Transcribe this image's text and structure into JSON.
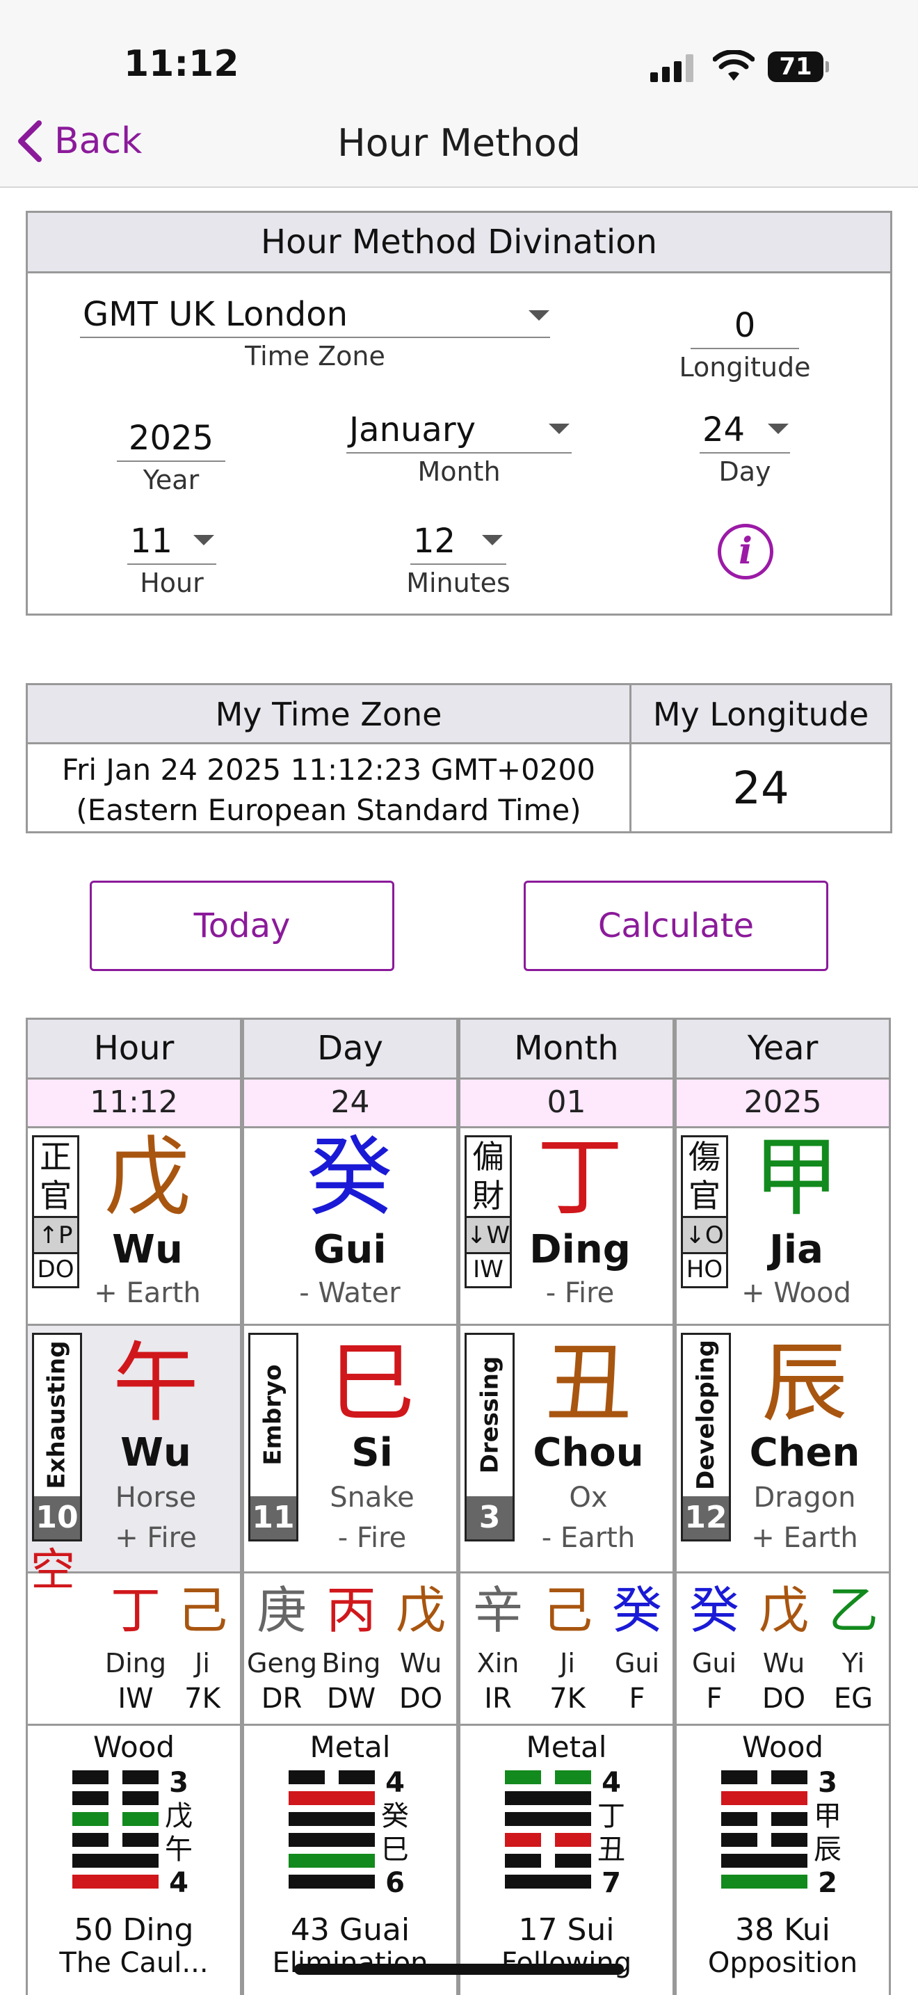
{
  "status": {
    "time": "11:12",
    "battery": "71"
  },
  "nav": {
    "back_label": "Back",
    "title": "Hour Method"
  },
  "panel": {
    "title": "Hour Method Divination",
    "timezone": {
      "value": "GMT UK London",
      "label": "Time Zone"
    },
    "longitude": {
      "value": "0",
      "label": "Longitude"
    },
    "year": {
      "value": "2025",
      "label": "Year"
    },
    "month": {
      "value": "January",
      "label": "Month"
    },
    "day": {
      "value": "24",
      "label": "Day"
    },
    "hour": {
      "value": "11",
      "label": "Hour"
    },
    "minutes": {
      "value": "12",
      "label": "Minutes"
    },
    "info_glyph": "i"
  },
  "mytz": {
    "tz_header": "My Time Zone",
    "lon_header": "My Longitude",
    "tz_line1": "Fri Jan 24 2025 11:12:23 GMT+0200",
    "tz_line2": "(Eastern European Standard Time)",
    "lon_value": "24"
  },
  "buttons": {
    "today": "Today",
    "calculate": "Calculate"
  },
  "colors": {
    "accent": "#8b1a9a",
    "fire": "#d0171b",
    "earth": "#a85510",
    "water": "#1a1ad6",
    "wood": "#128a1d",
    "metal": "#666666"
  },
  "pillars": [
    {
      "header": "Hour",
      "sub": "11:12",
      "stem": {
        "char": "戊",
        "pinyin": "Wu",
        "element": "+ Earth",
        "color": "#a85510",
        "god_chars": "正官",
        "god_mid": "↑P",
        "god_bot": "DO"
      },
      "branch": {
        "char": "午",
        "pinyin": "Wu",
        "animal": "Horse",
        "element": "+ Fire",
        "color": "#d0171b",
        "stage": "Exhausting",
        "stage_num": "10",
        "void": "空"
      },
      "hidden": [
        {
          "char": "丁",
          "pinyin": "Ding",
          "god": "IW",
          "color": "#d0171b"
        },
        {
          "char": "己",
          "pinyin": "Ji",
          "god": "7K",
          "color": "#a85510"
        }
      ],
      "hex": {
        "element": "Wood",
        "name": "50 Ding",
        "desc": "The Caul...",
        "side": [
          "3",
          "戊",
          "午",
          "4"
        ]
      }
    },
    {
      "header": "Day",
      "sub": "24",
      "stem": {
        "char": "癸",
        "pinyin": "Gui",
        "element": "- Water",
        "color": "#1a1ad6"
      },
      "branch": {
        "char": "巳",
        "pinyin": "Si",
        "animal": "Snake",
        "element": "- Fire",
        "color": "#d0171b",
        "stage": "Embryo",
        "stage_num": "11"
      },
      "hidden": [
        {
          "char": "庚",
          "pinyin": "Geng",
          "god": "DR",
          "color": "#666666"
        },
        {
          "char": "丙",
          "pinyin": "Bing",
          "god": "DW",
          "color": "#d0171b"
        },
        {
          "char": "戊",
          "pinyin": "Wu",
          "god": "DO",
          "color": "#a85510"
        }
      ],
      "hex": {
        "element": "Metal",
        "name": "43 Guai",
        "desc": "Elimination",
        "side": [
          "4",
          "癸",
          "巳",
          "6"
        ]
      }
    },
    {
      "header": "Month",
      "sub": "01",
      "stem": {
        "char": "丁",
        "pinyin": "Ding",
        "element": "- Fire",
        "color": "#d0171b",
        "god_chars": "偏財",
        "god_mid": "↓W",
        "god_bot": "IW"
      },
      "branch": {
        "char": "丑",
        "pinyin": "Chou",
        "animal": "Ox",
        "element": "- Earth",
        "color": "#a85510",
        "stage": "Dressing",
        "stage_num": "3"
      },
      "hidden": [
        {
          "char": "辛",
          "pinyin": "Xin",
          "god": "IR",
          "color": "#666666"
        },
        {
          "char": "己",
          "pinyin": "Ji",
          "god": "7K",
          "color": "#a85510"
        },
        {
          "char": "癸",
          "pinyin": "Gui",
          "god": "F",
          "color": "#1a1ad6"
        }
      ],
      "hex": {
        "element": "Metal",
        "name": "17 Sui",
        "desc": "Following",
        "side": [
          "4",
          "丁",
          "丑",
          "7"
        ]
      }
    },
    {
      "header": "Year",
      "sub": "2025",
      "stem": {
        "char": "甲",
        "pinyin": "Jia",
        "element": "+ Wood",
        "color": "#128a1d",
        "god_chars": "傷官",
        "god_mid": "↓O",
        "god_bot": "HO"
      },
      "branch": {
        "char": "辰",
        "pinyin": "Chen",
        "animal": "Dragon",
        "element": "+ Earth",
        "color": "#a85510",
        "stage": "Developing",
        "stage_num": "12"
      },
      "hidden": [
        {
          "char": "癸",
          "pinyin": "Gui",
          "god": "F",
          "color": "#1a1ad6"
        },
        {
          "char": "戊",
          "pinyin": "Wu",
          "god": "DO",
          "color": "#a85510"
        },
        {
          "char": "乙",
          "pinyin": "Yi",
          "god": "EG",
          "color": "#128a1d"
        }
      ],
      "hex": {
        "element": "Wood",
        "name": "38 Kui",
        "desc": "Opposition",
        "side": [
          "3",
          "甲",
          "辰",
          "2"
        ]
      }
    }
  ],
  "hex_lines": [
    [
      [
        0,
        1,
        "#111"
      ],
      [
        0,
        1,
        "#111"
      ],
      [
        1,
        0,
        "#128a1d"
      ],
      [
        0,
        1,
        "#111"
      ],
      [
        1,
        1,
        "#111"
      ],
      [
        1,
        1,
        "#d0171b"
      ],
      [
        1,
        1,
        "#111"
      ]
    ],
    [
      [
        0,
        1,
        "#111"
      ],
      [
        1,
        1,
        "#d0171b"
      ],
      [
        1,
        1,
        "#111"
      ],
      [
        1,
        1,
        "#111"
      ],
      [
        1,
        1,
        "#128a1d"
      ],
      [
        1,
        1,
        "#111"
      ]
    ],
    [
      [
        0,
        1,
        "#128a1d"
      ],
      [
        1,
        1,
        "#111"
      ],
      [
        1,
        1,
        "#111"
      ],
      [
        0,
        1,
        "#d0171b"
      ],
      [
        0,
        1,
        "#111"
      ],
      [
        1,
        1,
        "#111"
      ]
    ],
    [
      [
        0,
        1,
        "#111"
      ],
      [
        1,
        1,
        "#d0171b"
      ],
      [
        0,
        1,
        "#111"
      ],
      [
        0,
        1,
        "#111"
      ],
      [
        1,
        1,
        "#111"
      ],
      [
        1,
        1,
        "#128a1d"
      ]
    ]
  ]
}
